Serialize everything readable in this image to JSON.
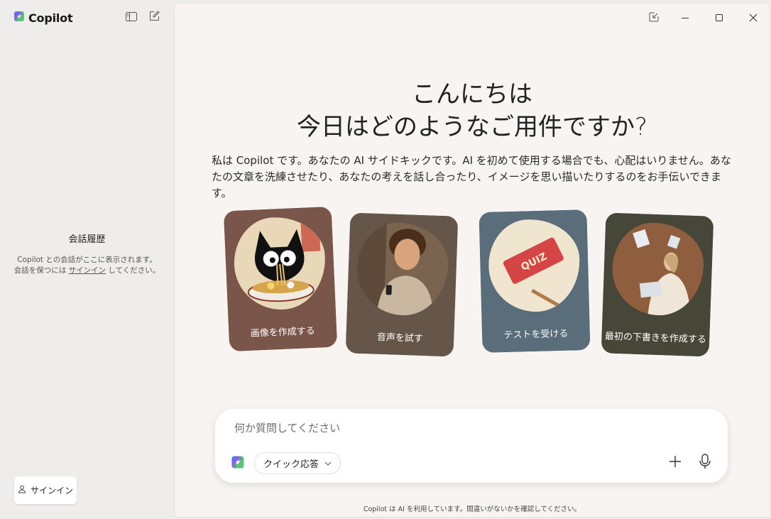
{
  "sidebar": {
    "brand": "Copilot",
    "history_title": "会話履歴",
    "history_line1": "Copilot との会話がここに表示されます。",
    "history_line2_prefix": "会話を保つには ",
    "history_link": "サインイン",
    "history_line2_suffix": " してください。",
    "signin_label": "サインイン"
  },
  "main": {
    "greeting_line1": "こんにちは",
    "greeting_line2": "今日はどのようなご用件ですか?",
    "intro": "私は Copilot です。あなたの AI サイドキックです。AI を初めて使用する場合でも、心配はいりません。あなたの文章を洗練させたり、あなたの考えを話し合ったり、イメージを思い描いたりするのをお手伝いできます。",
    "cards": [
      {
        "label": "画像を作成する",
        "color": "#7a554a"
      },
      {
        "label": "音声を試す",
        "color": "#655649"
      },
      {
        "label": "テストを受ける",
        "color": "#5a6d7a"
      },
      {
        "label": "最初の下書きを作成する",
        "color": "#474739"
      }
    ],
    "composer": {
      "placeholder": "何か質問してください",
      "mode_label": "クイック応答"
    },
    "disclaimer": "Copilot は AI を利用しています。間違いがないかを確認してください。"
  }
}
